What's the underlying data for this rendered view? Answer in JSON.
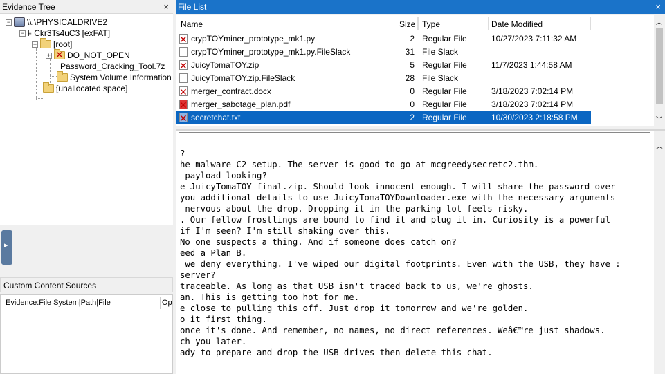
{
  "evidence_tree": {
    "title": "Evidence Tree",
    "close": "×",
    "nodes": {
      "drive": "\\\\.\\PHYSICALDRIVE2",
      "partition": "Ckr3Ts4uC3 [exFAT]",
      "root": "[root]",
      "do_not_open": "DO_NOT_OPEN",
      "password_tool": "Password_Cracking_Tool.7z",
      "svi": "System Volume Information",
      "unallocated": "[unallocated space]"
    }
  },
  "custom_content": {
    "title": "Custom Content Sources",
    "col_evidence": "Evidence:File System|Path|File",
    "col_op": "Op"
  },
  "file_list": {
    "title": "File List",
    "close": "×",
    "columns": {
      "name": "Name",
      "size": "Size",
      "type": "Type",
      "date": "Date Modified"
    },
    "rows": [
      {
        "name": "crypTOYminer_prototype_mk1.py",
        "size": "2",
        "type": "Regular File",
        "date": "10/27/2023 7:11:32 AM"
      },
      {
        "name": "crypTOYminer_prototype_mk1.py.FileSlack",
        "size": "31",
        "type": "File Slack",
        "date": ""
      },
      {
        "name": "JuicyTomaTOY.zip",
        "size": "5",
        "type": "Regular File",
        "date": "11/7/2023 1:44:58 AM"
      },
      {
        "name": "JuicyTomaTOY.zip.FileSlack",
        "size": "28",
        "type": "File Slack",
        "date": ""
      },
      {
        "name": "merger_contract.docx",
        "size": "0",
        "type": "Regular File",
        "date": "3/18/2023 7:02:14 PM"
      },
      {
        "name": "merger_sabotage_plan.pdf",
        "size": "0",
        "type": "Regular File",
        "date": "3/18/2023 7:02:14 PM"
      },
      {
        "name": "secretchat.txt",
        "size": "2",
        "type": "Regular File",
        "date": "10/30/2023 2:18:58 PM"
      }
    ]
  },
  "viewer": {
    "lines": [
      "?",
      "he malware C2 setup. The server is good to go at mcgreedysecretc2.thm.",
      " payload looking?",
      "e JuicyTomaTOY_final.zip. Should look innocent enough. I will share the password over",
      "you additional details to use JuicyTomaTOYDownloader.exe with the necessary arguments",
      " nervous about the drop. Dropping it in the parking lot feels risky.",
      ". Our fellow frostlings are bound to find it and plug it in. Curiosity is a powerful",
      "if I'm seen? I'm still shaking over this.",
      "No one suspects a thing. And if someone does catch on?",
      "eed a Plan B.",
      " we deny everything. I've wiped our digital footprints. Even with the USB, they have :",
      "server?",
      "traceable. As long as that USB isn't traced back to us, we're ghosts.",
      "an. This is getting too hot for me.",
      "e close to pulling this off. Just drop it tomorrow and we're golden.",
      "o it first thing.",
      "once it's done. And remember, no names, no direct references. Weâ€™re just shadows.",
      "ch you later.",
      "ady to prepare and drop the USB drives then delete this chat."
    ]
  }
}
